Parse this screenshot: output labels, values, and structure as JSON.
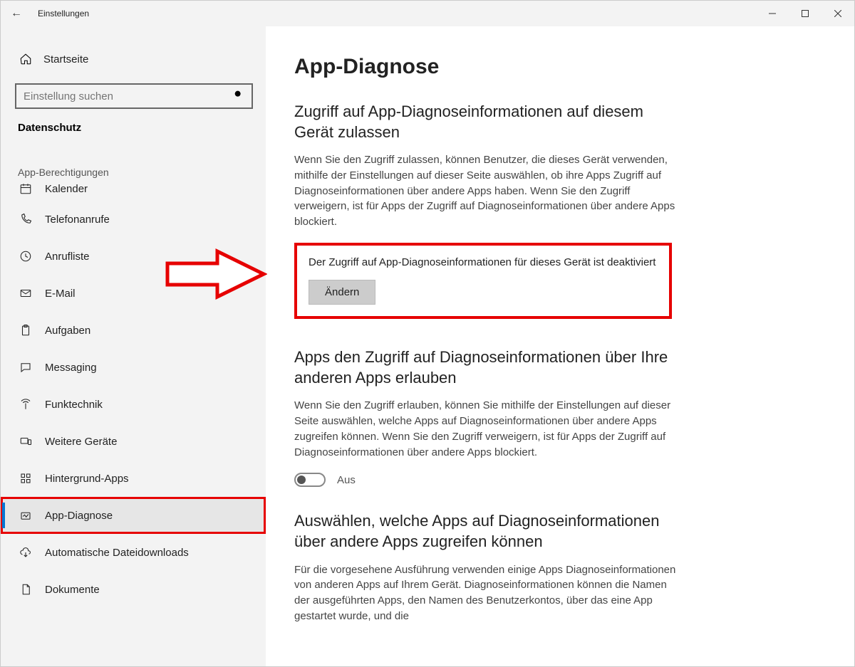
{
  "titlebar": {
    "title": "Einstellungen"
  },
  "sidebar": {
    "home": "Startseite",
    "search_placeholder": "Einstellung suchen",
    "category": "Datenschutz",
    "subheading": "App-Berechtigungen",
    "items": [
      {
        "label": "Kalender"
      },
      {
        "label": "Telefonanrufe"
      },
      {
        "label": "Anrufliste"
      },
      {
        "label": "E-Mail"
      },
      {
        "label": "Aufgaben"
      },
      {
        "label": "Messaging"
      },
      {
        "label": "Funktechnik"
      },
      {
        "label": "Weitere Geräte"
      },
      {
        "label": "Hintergrund-Apps"
      },
      {
        "label": "App-Diagnose"
      },
      {
        "label": "Automatische Dateidownloads"
      },
      {
        "label": "Dokumente"
      }
    ]
  },
  "main": {
    "heading": "App-Diagnose",
    "section1": {
      "title": "Zugriff auf App-Diagnoseinformationen auf diesem Gerät zulassen",
      "body": "Wenn Sie den Zugriff zulassen, können Benutzer, die dieses Gerät verwenden, mithilfe der Einstellungen auf dieser Seite auswählen, ob ihre Apps Zugriff auf Diagnoseinformationen über andere Apps haben. Wenn Sie den Zugriff verweigern, ist für Apps der Zugriff auf Diagnoseinformationen über andere Apps blockiert.",
      "status": "Der Zugriff auf App-Diagnoseinformationen für dieses Gerät ist deaktiviert",
      "change_button": "Ändern"
    },
    "section2": {
      "title": "Apps den Zugriff auf Diagnoseinformationen über Ihre anderen Apps erlauben",
      "body": "Wenn Sie den Zugriff erlauben, können Sie mithilfe der Einstellungen auf dieser Seite auswählen, welche Apps auf Diagnoseinformationen über andere Apps zugreifen können. Wenn Sie den Zugriff verweigern, ist für Apps der Zugriff auf Diagnoseinformationen über andere Apps blockiert.",
      "toggle_label": "Aus"
    },
    "section3": {
      "title": "Auswählen, welche Apps auf Diagnoseinformationen über andere Apps zugreifen können",
      "body": "Für die vorgesehene Ausführung verwenden einige Apps Diagnoseinformationen von anderen Apps auf Ihrem Gerät. Diagnoseinformationen können die Namen der ausgeführten Apps, den Namen des Benutzerkontos, über das eine App gestartet wurde, und die"
    }
  }
}
